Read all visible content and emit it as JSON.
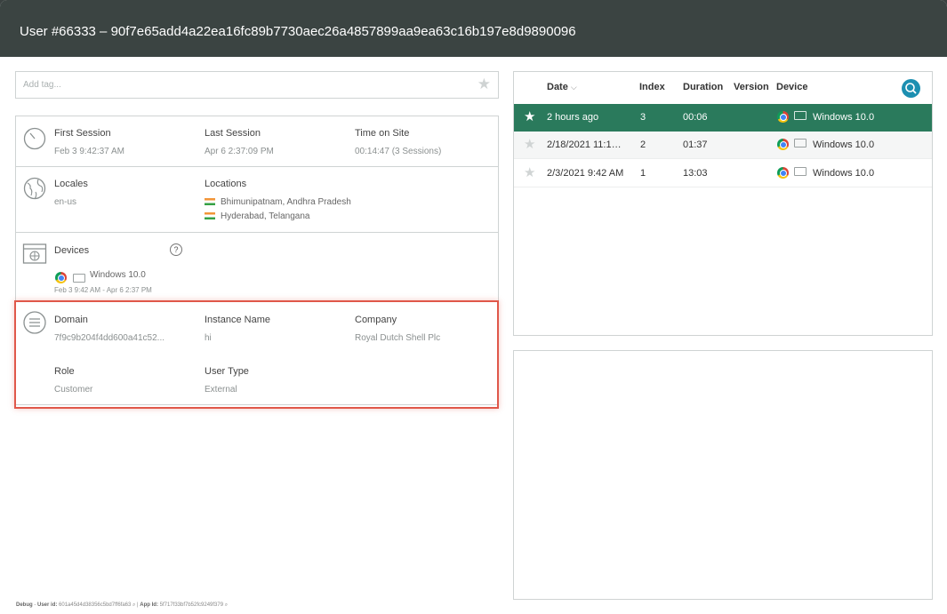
{
  "window": {
    "title": "User #66333 – 90f7e65add4a22ea16fc89b7730aec26a4857899aa9ea63c16b197e8d9890096"
  },
  "tags": {
    "placeholder": "Add tag..."
  },
  "summary": {
    "first_session_label": "First Session",
    "first_session_value": "Feb 3 9:42:37 AM",
    "last_session_label": "Last Session",
    "last_session_value": "Apr 6 2:37:09 PM",
    "time_on_site_label": "Time on Site",
    "time_on_site_value": "00:14:47 (3 Sessions)"
  },
  "locales": {
    "label": "Locales",
    "value": "en-us",
    "locations_label": "Locations",
    "locations": [
      "Bhimunipatnam, Andhra Pradesh",
      "Hyderabad, Telangana"
    ]
  },
  "devices": {
    "label": "Devices",
    "help": "?",
    "os": "Windows 10.0",
    "range": "Feb 3 9:42 AM - Apr 6 2:37 PM"
  },
  "details": {
    "domain_label": "Domain",
    "domain_value": "7f9c9b204f4dd600a41c52...",
    "instance_label": "Instance Name",
    "instance_value": "hi",
    "company_label": "Company",
    "company_value": "Royal Dutch Shell Plc",
    "role_label": "Role",
    "role_value": "Customer",
    "usertype_label": "User Type",
    "usertype_value": "External"
  },
  "sessions": {
    "columns": {
      "date": "Date",
      "date_sort": "⌵",
      "index": "Index",
      "duration": "Duration",
      "version": "Version",
      "device": "Device"
    },
    "rows": [
      {
        "date": "2 hours ago",
        "index": "3",
        "duration": "00:06",
        "os": "Windows 10.0",
        "starred": true
      },
      {
        "date": "2/18/2021 11:1…",
        "index": "2",
        "duration": "01:37",
        "os": "Windows 10.0",
        "starred": false
      },
      {
        "date": "2/3/2021 9:42 AM",
        "index": "1",
        "duration": "13:03",
        "os": "Windows 10.0",
        "starred": false
      }
    ],
    "star_glyph": "★"
  },
  "debug": {
    "prefix": "Debug",
    "user_id_label": "User id:",
    "user_id": "601a45d4d38356c5bd7ff6fa63",
    "app_id_label": "App Id:",
    "app_id": "5f717f33bf7b52fc9249f379"
  },
  "colors": {
    "selected_row": "#2a7a5c",
    "titlebar": "#3b4442",
    "highlight": "#e0584a",
    "search": "#1c8fb1"
  }
}
